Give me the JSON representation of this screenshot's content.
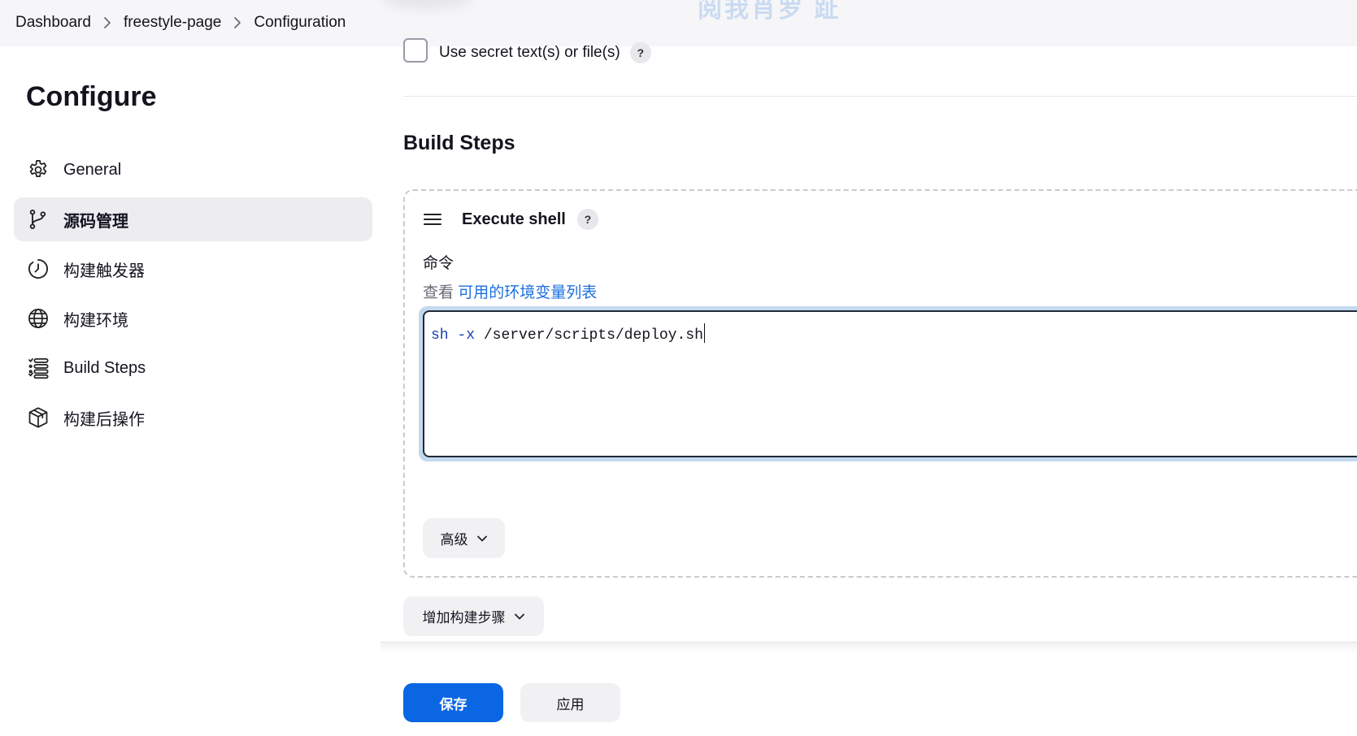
{
  "breadcrumb": {
    "items": [
      "Dashboard",
      "freestyle-page",
      "Configuration"
    ]
  },
  "sidebar": {
    "title": "Configure",
    "items": [
      {
        "label": "General",
        "icon": "gear-icon"
      },
      {
        "label": "源码管理",
        "icon": "branch-icon",
        "active": true
      },
      {
        "label": "构建触发器",
        "icon": "clock-icon"
      },
      {
        "label": "构建环境",
        "icon": "globe-icon"
      },
      {
        "label": "Build Steps",
        "icon": "list-icon"
      },
      {
        "label": "构建后操作",
        "icon": "package-icon"
      }
    ]
  },
  "main": {
    "secret_checkbox_label": "Use secret text(s) or file(s)",
    "help": "?",
    "build_steps_title": "Build Steps",
    "step": {
      "title": "Execute shell",
      "command_label": "命令",
      "env_prefix": "查看",
      "env_link": "可用的环境变量列表",
      "command": {
        "keyword": "sh",
        "flag": "-x",
        "path": "/server/scripts/deploy.sh"
      },
      "advanced_label": "高级"
    },
    "add_step_label": "增加构建步骤"
  },
  "footer": {
    "save_label": "保存",
    "apply_label": "应用"
  },
  "colors": {
    "primary": "#0b66e4",
    "link": "#1c6fe0",
    "active_bg": "#ececf1"
  }
}
